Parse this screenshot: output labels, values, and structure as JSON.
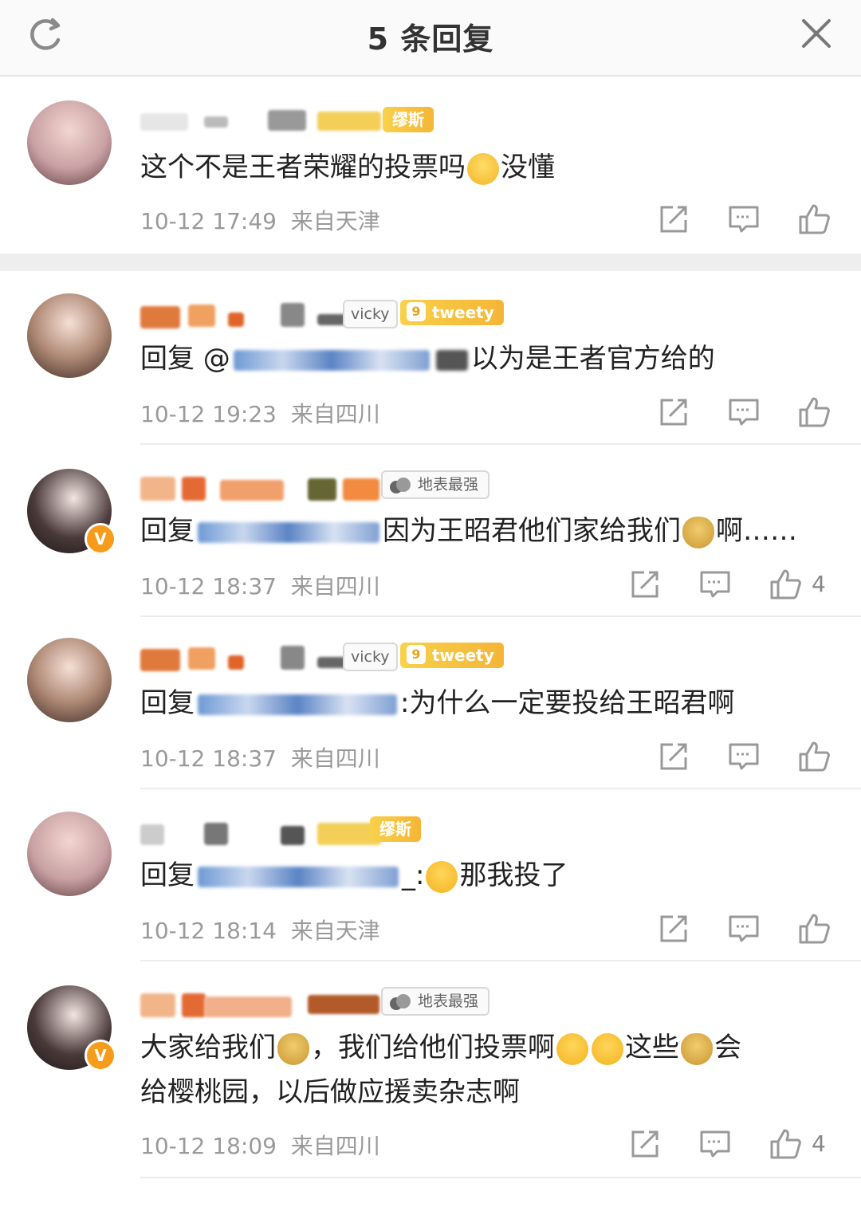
{
  "header": {
    "title": "5 条回复",
    "refresh_icon": "refresh-icon",
    "close_icon": "close-icon"
  },
  "comments": [
    {
      "name_badge": "缪斯",
      "text": "这个不是王者荣耀的投票吗",
      "text_after_emoji": "没懂",
      "time": "10-12 17:49",
      "location": "来自天津",
      "likes": ""
    },
    {
      "name_tag": "vicky",
      "badge_level": "9",
      "badge": "tweety",
      "reply_prefix": "回复 @",
      "text": "以为是王者官方给的",
      "time": "10-12 19:23",
      "location": "来自四川",
      "likes": ""
    },
    {
      "badge": "地表最强",
      "reply_prefix": "回复",
      "text": "因为王昭君他们家给我们",
      "text_tail": "啊……",
      "time": "10-12 18:37",
      "location": "来自四川",
      "likes": "4"
    },
    {
      "name_tag": "vicky",
      "badge_level": "9",
      "badge": "tweety",
      "reply_prefix": "回复",
      "text": ":为什么一定要投给王昭君啊",
      "time": "10-12 18:37",
      "location": "来自四川",
      "likes": ""
    },
    {
      "name_badge": "缪斯",
      "reply_prefix": "回复",
      "text_prefix": "_:",
      "text": "那我投了",
      "time": "10-12 18:14",
      "location": "来自天津",
      "likes": ""
    },
    {
      "badge": "地表最强",
      "line1_a": "大家给我们",
      "line1_b": "，我们给他们投票啊",
      "line1_c": "这些",
      "line1_d": "会",
      "line2": "给樱桃园，以后做应援卖杂志啊",
      "time": "10-12 18:09",
      "location": "来自四川",
      "likes": "4"
    }
  ],
  "colors": {
    "accent_orange": "#f79b1b",
    "badge_gold": "#f5b536",
    "meta_gray": "#9a9a9a",
    "mention_blue": "#5b84c5"
  },
  "icons": {
    "share": "share-icon",
    "comment": "comment-icon",
    "like": "thumbs-up-icon",
    "verified": "verified-badge-icon"
  }
}
